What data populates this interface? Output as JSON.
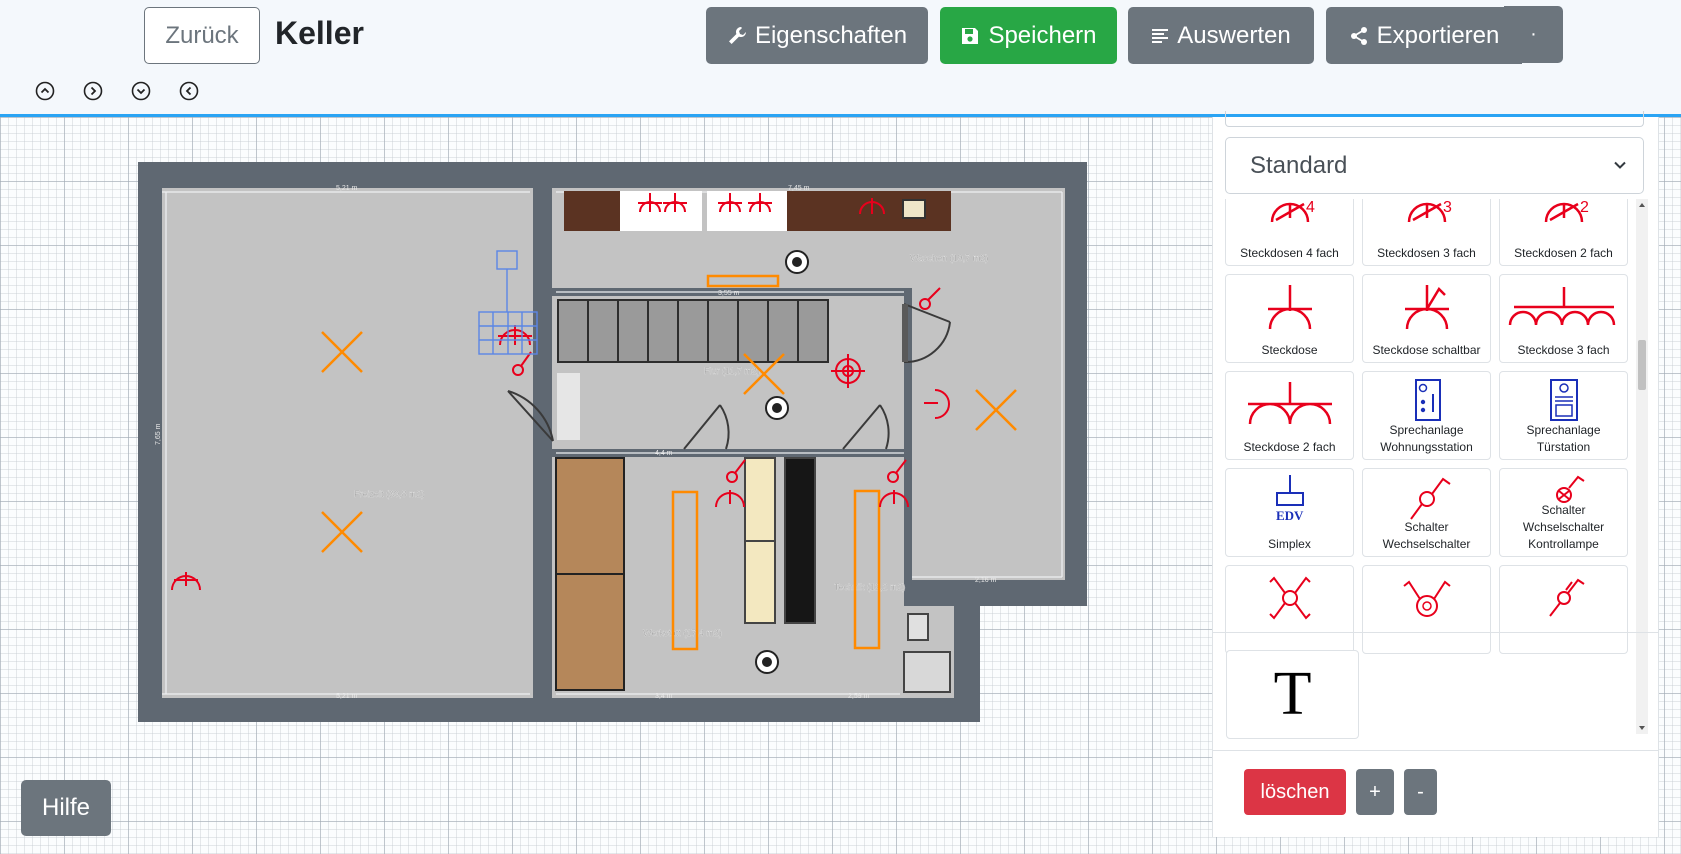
{
  "header": {
    "back_label": "Zurück",
    "title": "Keller",
    "buttons": {
      "properties": "Eigenschaften",
      "save": "Speichern",
      "evaluate": "Auswerten",
      "export": "Exportieren"
    },
    "nav_icons": [
      "chevron-up-icon",
      "chevron-right-icon",
      "chevron-down-icon",
      "chevron-left-icon"
    ]
  },
  "colors": {
    "accent_line": "#2aa4f4",
    "save_green": "#28a745",
    "button_gray": "#6c757d",
    "danger_red": "#dc3545",
    "symbol_red": "#e8001c",
    "symbol_blue": "#1a2fb8",
    "wall_gray": "#5f6872",
    "floor_gray": "#c3c3c3",
    "light_orange": "#ff8a00"
  },
  "floorplan": {
    "rooms": {
      "freizeit": "Freizeit (39,8 m2)",
      "waschen": "Waschen (19,7 m2)",
      "flur": "Flur (11,7 m2)",
      "werkstatt": "Werkstatt (17,4 m2)",
      "technik": "Technik (12,2 m2)"
    },
    "dimensions": {
      "freizeit_top": "5,21 m",
      "freizeit_bottom": "5,21 m",
      "waschen_top": "7,45 m",
      "flur_top": "3,55 m",
      "werkstatt_top": "4,4 m",
      "werkstatt_bottom": "3,4 m",
      "technik_bottom": "2,59 m",
      "right_bottom": "2,16 m",
      "freizeit_side": "7,65 m"
    }
  },
  "panel": {
    "category": "Standard",
    "symbols": [
      {
        "label": "Steckdosen 4 fach",
        "icon": "socket-4-icon"
      },
      {
        "label": "Steckdosen 3 fach",
        "icon": "socket-3-icon"
      },
      {
        "label": "Steckdosen 2 fach",
        "icon": "socket-2-icon"
      },
      {
        "label": "Steckdose",
        "icon": "socket-icon"
      },
      {
        "label": "Steckdose schaltbar",
        "icon": "switched-socket-icon"
      },
      {
        "label": "Steckdose 3 fach",
        "icon": "socket-triple-icon"
      },
      {
        "label": "Steckdose 2 fach",
        "icon": "socket-double-icon"
      },
      {
        "label": "Sprechanlage\nWohnungsstation",
        "icon": "intercom-apartment-icon"
      },
      {
        "label": "Sprechanlage\nTürstation",
        "icon": "intercom-door-icon"
      },
      {
        "label": "Simplex",
        "icon": "edv-simplex-icon"
      },
      {
        "label": "Schalter\nWechselschalter",
        "icon": "toggle-switch-icon"
      },
      {
        "label": "Schalter\nWchselschalter\nKontrollampe",
        "icon": "switch-indicator-icon"
      },
      {
        "label": "",
        "icon": "crossover-switch-icon"
      },
      {
        "label": "",
        "icon": "dimmer-icon"
      },
      {
        "label": "",
        "icon": "two-way-switch-icon"
      }
    ],
    "text_tool": "T",
    "delete_label": "löschen",
    "plus_label": "+",
    "minus_label": "-"
  },
  "help_label": "Hilfe"
}
